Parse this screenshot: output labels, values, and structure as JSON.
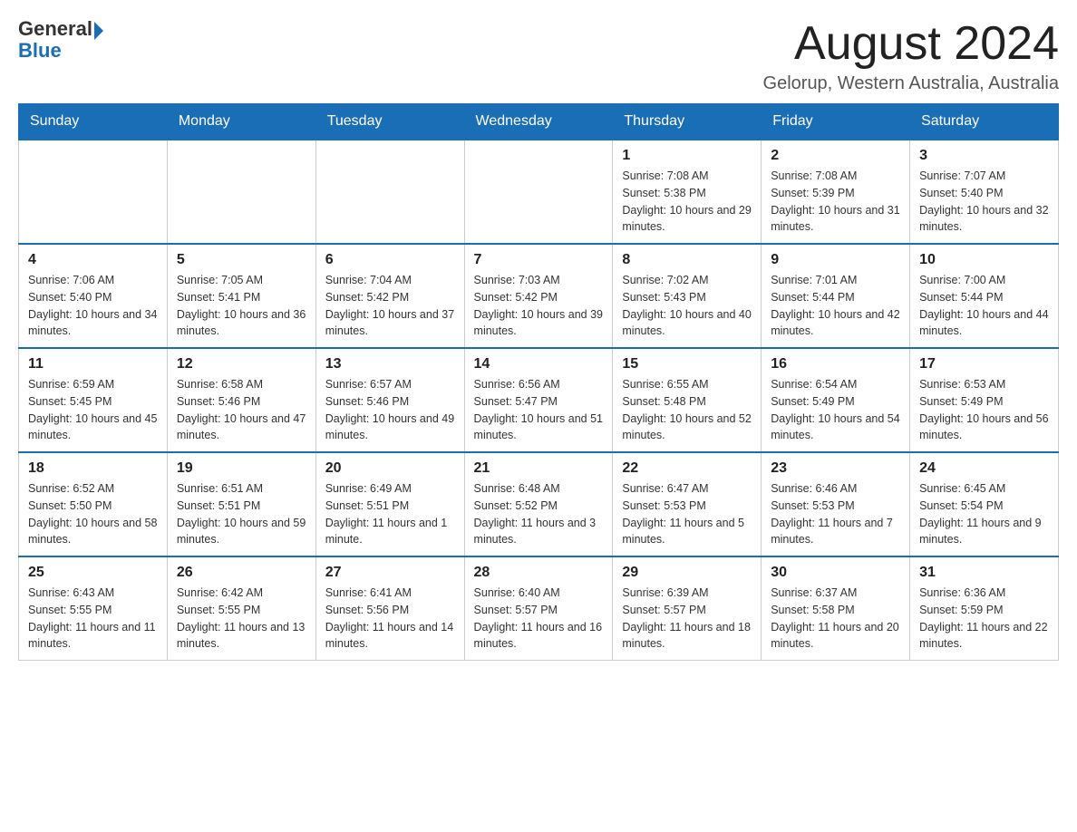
{
  "logo": {
    "general": "General",
    "blue": "Blue"
  },
  "header": {
    "month_year": "August 2024",
    "location": "Gelorup, Western Australia, Australia"
  },
  "days_of_week": [
    "Sunday",
    "Monday",
    "Tuesday",
    "Wednesday",
    "Thursday",
    "Friday",
    "Saturday"
  ],
  "weeks": [
    [
      {
        "day": "",
        "sunrise": "",
        "sunset": "",
        "daylight": ""
      },
      {
        "day": "",
        "sunrise": "",
        "sunset": "",
        "daylight": ""
      },
      {
        "day": "",
        "sunrise": "",
        "sunset": "",
        "daylight": ""
      },
      {
        "day": "",
        "sunrise": "",
        "sunset": "",
        "daylight": ""
      },
      {
        "day": "1",
        "sunrise": "Sunrise: 7:08 AM",
        "sunset": "Sunset: 5:38 PM",
        "daylight": "Daylight: 10 hours and 29 minutes."
      },
      {
        "day": "2",
        "sunrise": "Sunrise: 7:08 AM",
        "sunset": "Sunset: 5:39 PM",
        "daylight": "Daylight: 10 hours and 31 minutes."
      },
      {
        "day": "3",
        "sunrise": "Sunrise: 7:07 AM",
        "sunset": "Sunset: 5:40 PM",
        "daylight": "Daylight: 10 hours and 32 minutes."
      }
    ],
    [
      {
        "day": "4",
        "sunrise": "Sunrise: 7:06 AM",
        "sunset": "Sunset: 5:40 PM",
        "daylight": "Daylight: 10 hours and 34 minutes."
      },
      {
        "day": "5",
        "sunrise": "Sunrise: 7:05 AM",
        "sunset": "Sunset: 5:41 PM",
        "daylight": "Daylight: 10 hours and 36 minutes."
      },
      {
        "day": "6",
        "sunrise": "Sunrise: 7:04 AM",
        "sunset": "Sunset: 5:42 PM",
        "daylight": "Daylight: 10 hours and 37 minutes."
      },
      {
        "day": "7",
        "sunrise": "Sunrise: 7:03 AM",
        "sunset": "Sunset: 5:42 PM",
        "daylight": "Daylight: 10 hours and 39 minutes."
      },
      {
        "day": "8",
        "sunrise": "Sunrise: 7:02 AM",
        "sunset": "Sunset: 5:43 PM",
        "daylight": "Daylight: 10 hours and 40 minutes."
      },
      {
        "day": "9",
        "sunrise": "Sunrise: 7:01 AM",
        "sunset": "Sunset: 5:44 PM",
        "daylight": "Daylight: 10 hours and 42 minutes."
      },
      {
        "day": "10",
        "sunrise": "Sunrise: 7:00 AM",
        "sunset": "Sunset: 5:44 PM",
        "daylight": "Daylight: 10 hours and 44 minutes."
      }
    ],
    [
      {
        "day": "11",
        "sunrise": "Sunrise: 6:59 AM",
        "sunset": "Sunset: 5:45 PM",
        "daylight": "Daylight: 10 hours and 45 minutes."
      },
      {
        "day": "12",
        "sunrise": "Sunrise: 6:58 AM",
        "sunset": "Sunset: 5:46 PM",
        "daylight": "Daylight: 10 hours and 47 minutes."
      },
      {
        "day": "13",
        "sunrise": "Sunrise: 6:57 AM",
        "sunset": "Sunset: 5:46 PM",
        "daylight": "Daylight: 10 hours and 49 minutes."
      },
      {
        "day": "14",
        "sunrise": "Sunrise: 6:56 AM",
        "sunset": "Sunset: 5:47 PM",
        "daylight": "Daylight: 10 hours and 51 minutes."
      },
      {
        "day": "15",
        "sunrise": "Sunrise: 6:55 AM",
        "sunset": "Sunset: 5:48 PM",
        "daylight": "Daylight: 10 hours and 52 minutes."
      },
      {
        "day": "16",
        "sunrise": "Sunrise: 6:54 AM",
        "sunset": "Sunset: 5:49 PM",
        "daylight": "Daylight: 10 hours and 54 minutes."
      },
      {
        "day": "17",
        "sunrise": "Sunrise: 6:53 AM",
        "sunset": "Sunset: 5:49 PM",
        "daylight": "Daylight: 10 hours and 56 minutes."
      }
    ],
    [
      {
        "day": "18",
        "sunrise": "Sunrise: 6:52 AM",
        "sunset": "Sunset: 5:50 PM",
        "daylight": "Daylight: 10 hours and 58 minutes."
      },
      {
        "day": "19",
        "sunrise": "Sunrise: 6:51 AM",
        "sunset": "Sunset: 5:51 PM",
        "daylight": "Daylight: 10 hours and 59 minutes."
      },
      {
        "day": "20",
        "sunrise": "Sunrise: 6:49 AM",
        "sunset": "Sunset: 5:51 PM",
        "daylight": "Daylight: 11 hours and 1 minute."
      },
      {
        "day": "21",
        "sunrise": "Sunrise: 6:48 AM",
        "sunset": "Sunset: 5:52 PM",
        "daylight": "Daylight: 11 hours and 3 minutes."
      },
      {
        "day": "22",
        "sunrise": "Sunrise: 6:47 AM",
        "sunset": "Sunset: 5:53 PM",
        "daylight": "Daylight: 11 hours and 5 minutes."
      },
      {
        "day": "23",
        "sunrise": "Sunrise: 6:46 AM",
        "sunset": "Sunset: 5:53 PM",
        "daylight": "Daylight: 11 hours and 7 minutes."
      },
      {
        "day": "24",
        "sunrise": "Sunrise: 6:45 AM",
        "sunset": "Sunset: 5:54 PM",
        "daylight": "Daylight: 11 hours and 9 minutes."
      }
    ],
    [
      {
        "day": "25",
        "sunrise": "Sunrise: 6:43 AM",
        "sunset": "Sunset: 5:55 PM",
        "daylight": "Daylight: 11 hours and 11 minutes."
      },
      {
        "day": "26",
        "sunrise": "Sunrise: 6:42 AM",
        "sunset": "Sunset: 5:55 PM",
        "daylight": "Daylight: 11 hours and 13 minutes."
      },
      {
        "day": "27",
        "sunrise": "Sunrise: 6:41 AM",
        "sunset": "Sunset: 5:56 PM",
        "daylight": "Daylight: 11 hours and 14 minutes."
      },
      {
        "day": "28",
        "sunrise": "Sunrise: 6:40 AM",
        "sunset": "Sunset: 5:57 PM",
        "daylight": "Daylight: 11 hours and 16 minutes."
      },
      {
        "day": "29",
        "sunrise": "Sunrise: 6:39 AM",
        "sunset": "Sunset: 5:57 PM",
        "daylight": "Daylight: 11 hours and 18 minutes."
      },
      {
        "day": "30",
        "sunrise": "Sunrise: 6:37 AM",
        "sunset": "Sunset: 5:58 PM",
        "daylight": "Daylight: 11 hours and 20 minutes."
      },
      {
        "day": "31",
        "sunrise": "Sunrise: 6:36 AM",
        "sunset": "Sunset: 5:59 PM",
        "daylight": "Daylight: 11 hours and 22 minutes."
      }
    ]
  ]
}
